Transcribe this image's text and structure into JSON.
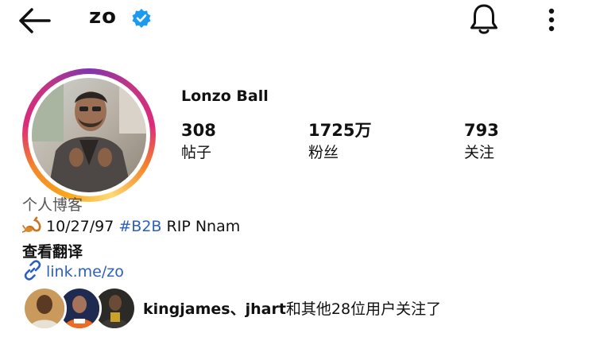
{
  "header": {
    "username": "zo",
    "verified": true,
    "icons": [
      "back-arrow-icon",
      "verified-badge-icon",
      "bell-icon",
      "more-vertical-icon"
    ]
  },
  "profile": {
    "display_name": "Lonzo Ball",
    "stats": [
      {
        "value": "308",
        "label": "帖子"
      },
      {
        "value": "1725万",
        "label": "粉丝"
      },
      {
        "value": "793",
        "label": "关注"
      }
    ]
  },
  "bio": {
    "category": "个人博客",
    "emoji_icon": "scorpion-icon",
    "date_text": "10/27/97",
    "hashtag": "#B2B",
    "rest_text": "RIP Nnam",
    "translate_label": "查看翻译",
    "link_text": "link.me/zo"
  },
  "followed_by": {
    "names": "kingjames、jhart",
    "suffix": "和其他28位用户关注了"
  },
  "colors": {
    "accent_link": "#2d5fbf",
    "verified": "#1a9bf0",
    "ring_gradient": [
      "#feda75",
      "#f58529",
      "#dd2a7b",
      "#8134af"
    ]
  }
}
